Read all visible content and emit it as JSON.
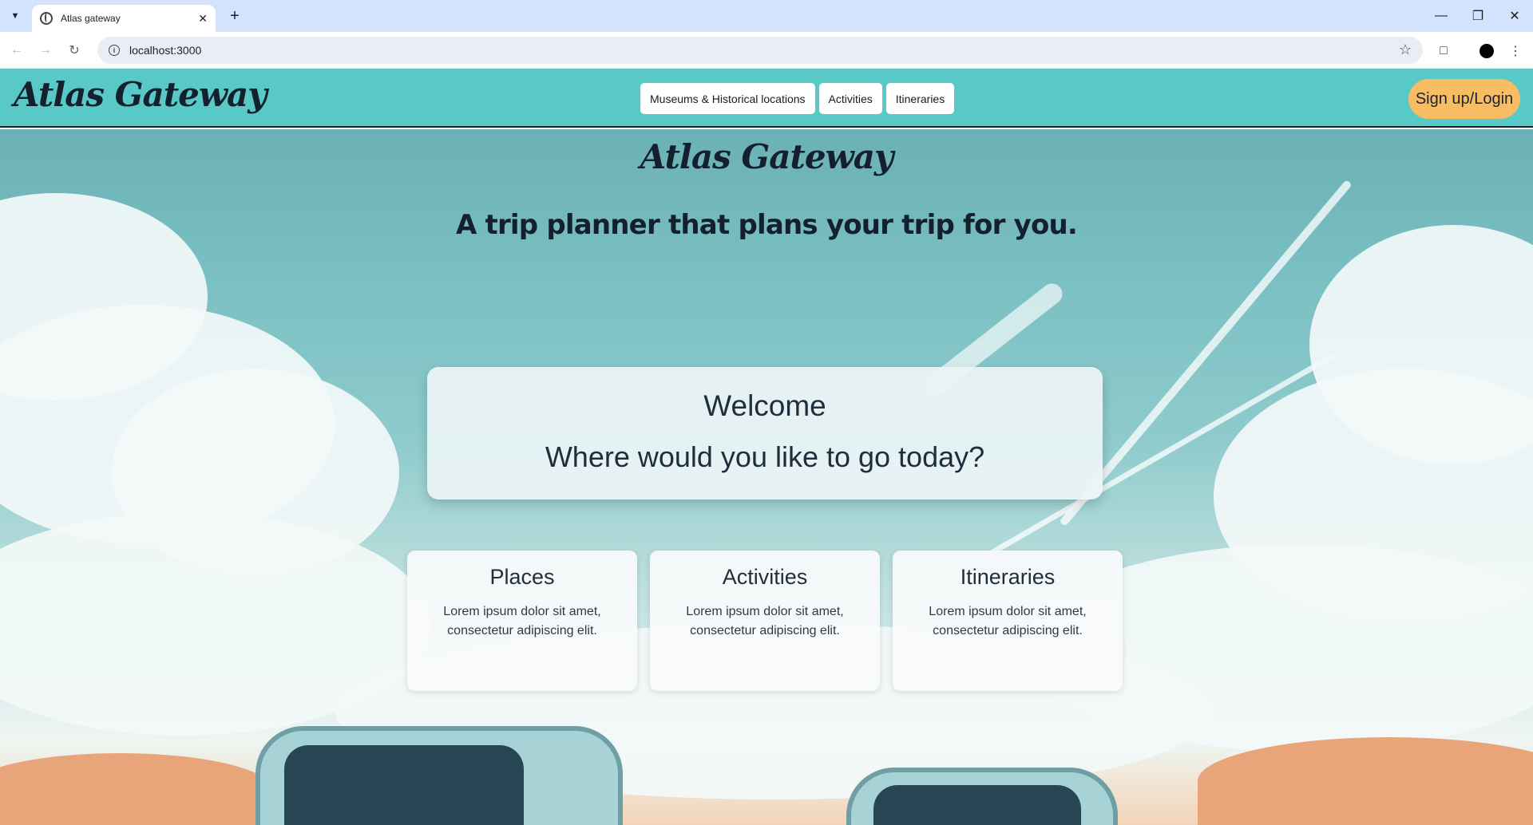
{
  "browser": {
    "tab_title": "Atlas gateway",
    "url": "localhost:3000"
  },
  "navbar": {
    "logo": "Atlas Gateway",
    "links": [
      {
        "label": "Museums & Historical locations"
      },
      {
        "label": "Activities"
      },
      {
        "label": "Itineraries"
      }
    ],
    "signup_label": "Sign up/Login"
  },
  "hero": {
    "title": "Atlas Gateway",
    "tagline": "A trip planner that plans your trip for you.",
    "welcome_heading": "Welcome",
    "welcome_question": "Where would you like to go today?"
  },
  "cards": [
    {
      "title": "Places",
      "text": "Lorem ipsum dolor sit amet, consectetur adipiscing elit."
    },
    {
      "title": "Activities",
      "text": "Lorem ipsum dolor sit amet, consectetur adipiscing elit."
    },
    {
      "title": "Itineraries",
      "text": "Lorem ipsum dolor sit amet, consectetur adipiscing elit."
    }
  ],
  "colors": {
    "navbar": "#58c9c7",
    "signup_button": "#f8bd63",
    "text_dark": "#14202e"
  },
  "icons": [
    "tab-list-icon",
    "globe-icon",
    "close-icon",
    "plus-icon",
    "minimize-icon",
    "restore-icon",
    "back-icon",
    "forward-icon",
    "reload-icon",
    "info-icon",
    "star-icon",
    "extensions-icon",
    "profile-icon",
    "menu-icon"
  ]
}
